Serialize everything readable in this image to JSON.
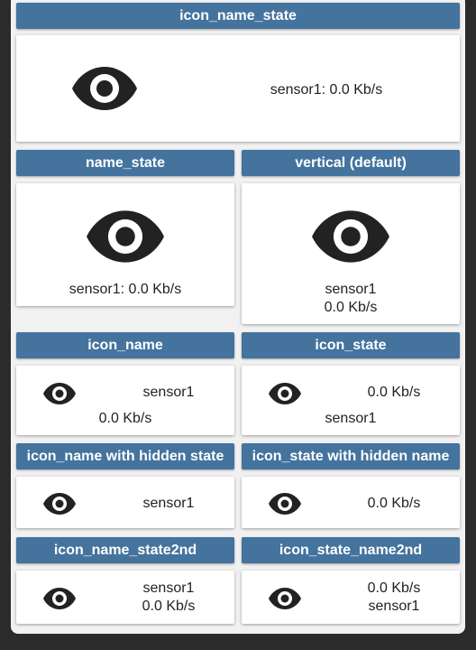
{
  "icon": "eye-icon",
  "colors": {
    "header_bg": "#44739e",
    "header_text": "#ffffff",
    "icon": "#222222"
  },
  "sections": {
    "icon_name_state": {
      "title": "icon_name_state",
      "text": "sensor1: 0.0 Kb/s"
    },
    "name_state": {
      "title": "name_state",
      "text": "sensor1: 0.0 Kb/s"
    },
    "vertical_default": {
      "title": "vertical (default)",
      "name": "sensor1",
      "state": "0.0 Kb/s"
    },
    "icon_name": {
      "title": "icon_name",
      "name": "sensor1",
      "state": "0.0 Kb/s"
    },
    "icon_state": {
      "title": "icon_state",
      "state": "0.0 Kb/s",
      "name": "sensor1"
    },
    "icon_name_hidden_state": {
      "title": "icon_name with hidden state",
      "name": "sensor1"
    },
    "icon_state_hidden_name": {
      "title": "icon_state with hidden name",
      "state": "0.0 Kb/s"
    },
    "icon_name_state2nd": {
      "title": "icon_name_state2nd",
      "name": "sensor1",
      "state": "0.0 Kb/s"
    },
    "icon_state_name2nd": {
      "title": "icon_state_name2nd",
      "state": "0.0 Kb/s",
      "name": "sensor1"
    }
  }
}
